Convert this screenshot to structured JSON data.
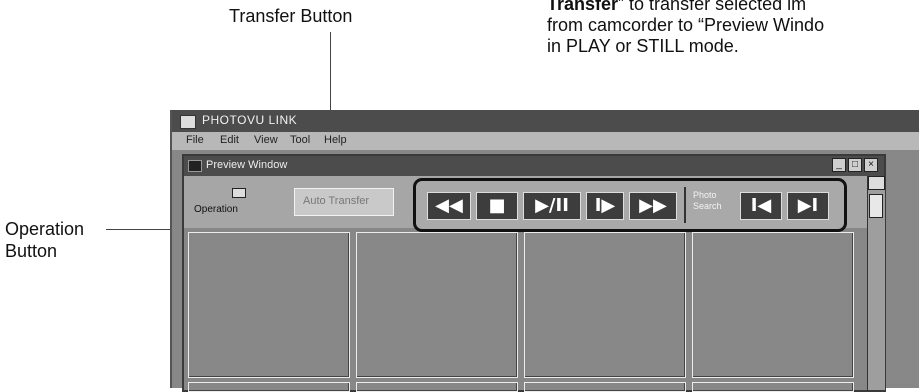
{
  "annotations": {
    "transfer_button": "Transfer Button",
    "note_line1_bold": "Transfer",
    "note_line1_rest": "” to transfer selected im",
    "note_line2": "from camcorder to “Preview Windo",
    "note_line3": "in PLAY or STILL mode.",
    "operation_button_line1": "Operation",
    "operation_button_line2": "Button"
  },
  "app": {
    "title": "PHOTOVU LINK",
    "menu": [
      "File",
      "Edit",
      "View",
      "Tool",
      "Help"
    ]
  },
  "preview_window": {
    "title": "Preview Window",
    "operation_button_label": "Operation",
    "transfer_button_label": "Auto Transfer",
    "controls": {
      "rewind": "◀◀",
      "stop": "■",
      "play_pause": "▶/II",
      "frame_advance": "I▶",
      "fast_forward": "▶▶",
      "photo_search_label": "Photo Search",
      "search_prev": "I◀",
      "search_next": "▶I"
    },
    "window_buttons": {
      "minimize": "_",
      "maximize": "□",
      "close": "×"
    }
  }
}
